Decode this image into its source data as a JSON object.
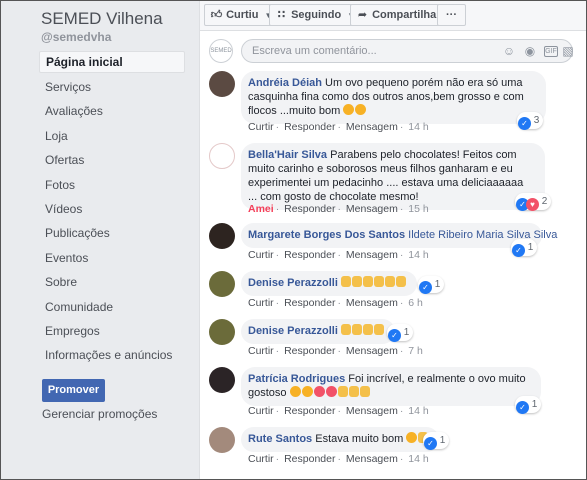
{
  "sidebar": {
    "page_name": "SEMED Vilhena",
    "page_handle": "@semedvha",
    "items": [
      {
        "label": "Página inicial",
        "active": true
      },
      {
        "label": "Serviços"
      },
      {
        "label": "Avaliações"
      },
      {
        "label": "Loja"
      },
      {
        "label": "Ofertas"
      },
      {
        "label": "Fotos"
      },
      {
        "label": "Vídeos"
      },
      {
        "label": "Publicações"
      },
      {
        "label": "Eventos"
      },
      {
        "label": "Sobre"
      },
      {
        "label": "Comunidade"
      },
      {
        "label": "Empregos"
      },
      {
        "label": "Informações e anúncios"
      }
    ],
    "promote_label": "Promover",
    "manage_label": "Gerenciar promoções"
  },
  "action_bar": {
    "liked_label": "Curtiu",
    "following_label": "Seguindo",
    "share_label": "Compartilhar",
    "more_label": "···"
  },
  "composer": {
    "placeholder": "Escreva um comentário...",
    "avatar_text": "SEMED VILHENA"
  },
  "colors": {
    "link_blue": "#385898",
    "button_blue": "#4267b2",
    "love_red": "#f33e58",
    "like_blue": "#2078f4"
  },
  "comments": [
    {
      "name": "Andréia Déiah",
      "text_lines": [
        "Um ovo pequeno porém não era só uma",
        "casquinha fina como dos outros anos,bem grosso e com flocos",
        "...muito bom"
      ],
      "emojis": [
        "smile-emoji",
        "smile-emoji"
      ],
      "reaction_count": "3",
      "like_action": "Curtir",
      "reply": "Responder",
      "message": "Mensagem",
      "time": "14 h"
    },
    {
      "name": "Bella'Hair Silva",
      "text_lines": [
        "Parabens pelo chocolates! Feitos com muito",
        "carinho e soborosos meus filhos ganharam e eu experimentei",
        "um pedacinho .... estava uma deliciaaaaaa ... com gosto de",
        "chocolate mesmo!"
      ],
      "reaction_count": "2",
      "like_action": "Amei",
      "reply": "Responder",
      "message": "Mensagem",
      "time": "15 h"
    },
    {
      "name": "Margarete Borges Dos Santos",
      "mention": "Ildete Ribeiro Maria Silva Silva",
      "reaction_count": "1",
      "like_action": "Curtir",
      "reply": "Responder",
      "message": "Mensagem",
      "time": "14 h"
    },
    {
      "name": "Denise Perazzolli",
      "emojis": [
        "clap-emoji",
        "clap-emoji",
        "clap-emoji",
        "clap-emoji",
        "clap-emoji",
        "clap-emoji"
      ],
      "reaction_count": "1",
      "like_action": "Curtir",
      "reply": "Responder",
      "message": "Mensagem",
      "time": "6 h"
    },
    {
      "name": "Denise Perazzolli",
      "emojis": [
        "clap-emoji",
        "clap-emoji",
        "clap-emoji",
        "clap-emoji"
      ],
      "reaction_count": "1",
      "like_action": "Curtir",
      "reply": "Responder",
      "message": "Mensagem",
      "time": "7 h"
    },
    {
      "name": "Patrícia Rodrigues",
      "text_lines": [
        "Foi incrível, e realmente o ovo muito",
        "gostoso"
      ],
      "emojis": [
        "grin-emoji",
        "grin-emoji",
        "heart-eyes-emoji",
        "heart-eyes-emoji",
        "clap-emoji",
        "clap-emoji",
        "clap-emoji"
      ],
      "reaction_count": "1",
      "like_action": "Curtir",
      "reply": "Responder",
      "message": "Mensagem",
      "time": "14 h"
    },
    {
      "name": "Rute Santos",
      "text_lines": [
        "Estava muito bom"
      ],
      "emojis": [
        "smile-emoji",
        "clap-emoji"
      ],
      "reaction_count": "1",
      "like_action": "Curtir",
      "reply": "Responder",
      "message": "Mensagem",
      "time": "14 h"
    }
  ]
}
